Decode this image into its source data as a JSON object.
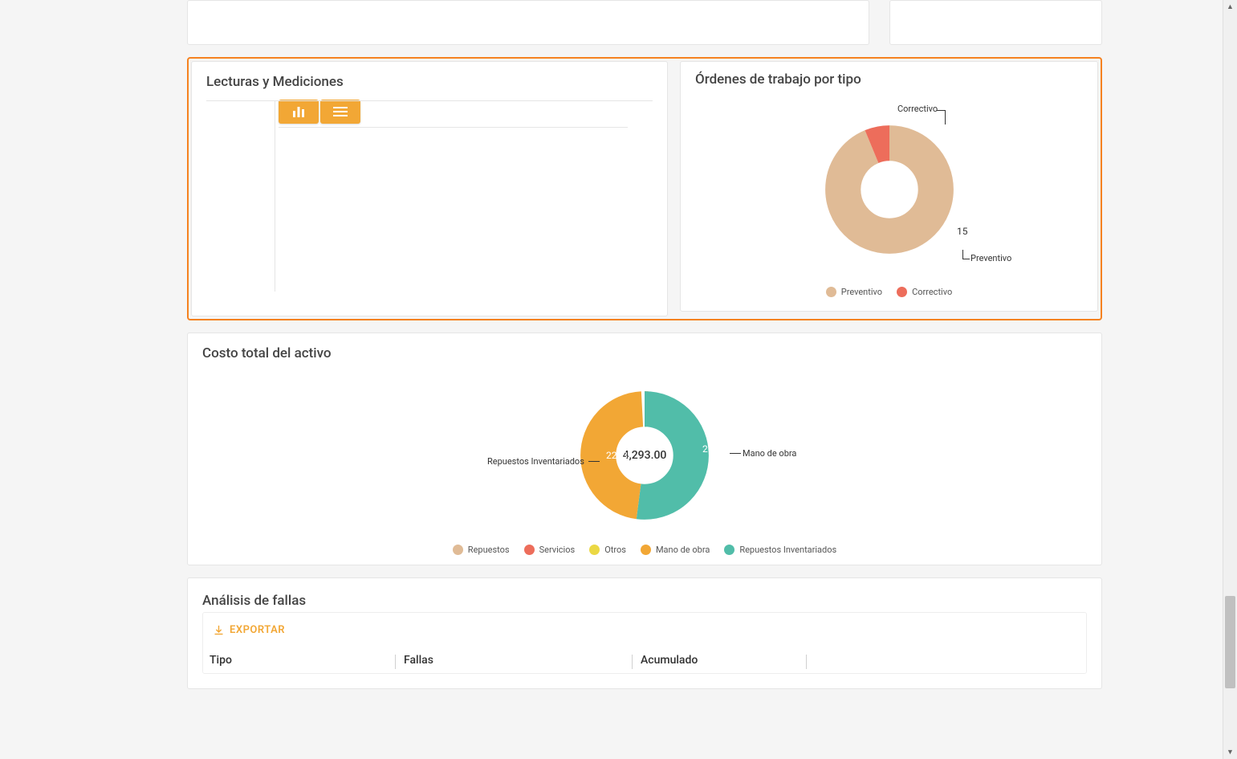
{
  "cards": {
    "readings": {
      "title": "Lecturas y Mediciones"
    },
    "orders": {
      "title": "Órdenes de trabajo por tipo",
      "labels": {
        "preventivo": "Preventivo",
        "correctivo": "Correctivo"
      },
      "values": {
        "preventivo": "15",
        "correctivo": "1"
      }
    },
    "cost": {
      "title": "Costo total del activo",
      "center_value": "4,293.00",
      "labels": {
        "repuestos": "Repuestos",
        "servicios": "Servicios",
        "otros": "Otros",
        "mano_obra": "Mano de obra",
        "repuestos_inv": "Repuestos Inventariados"
      },
      "values": {
        "mano_obra": "2000",
        "repuestos_inv": "2253"
      }
    },
    "failures": {
      "title": "Análisis de fallas",
      "export_label": "EXPORTAR",
      "columns": {
        "tipo": "Tipo",
        "fallas": "Fallas",
        "acumulado": "Acumulado"
      }
    }
  },
  "colors": {
    "tan": "#e0bb96",
    "coral": "#ed6d5b",
    "yellow": "#ebd844",
    "orange": "#f2a735",
    "teal": "#51bda9"
  },
  "chart_data": [
    {
      "type": "pie",
      "title": "Órdenes de trabajo por tipo",
      "series": [
        {
          "name": "Preventivo",
          "value": 15,
          "color": "#e0bb96"
        },
        {
          "name": "Correctivo",
          "value": 1,
          "color": "#ed6d5b"
        }
      ]
    },
    {
      "type": "pie",
      "title": "Costo total del activo",
      "center_total": 4293.0,
      "series": [
        {
          "name": "Repuestos",
          "value": 0,
          "color": "#e0bb96"
        },
        {
          "name": "Servicios",
          "value": 0,
          "color": "#ed6d5b"
        },
        {
          "name": "Otros",
          "value": 0,
          "color": "#ebd844"
        },
        {
          "name": "Mano de obra",
          "value": 2000,
          "color": "#f2a735"
        },
        {
          "name": "Repuestos Inventariados",
          "value": 2253,
          "color": "#51bda9"
        }
      ]
    }
  ]
}
